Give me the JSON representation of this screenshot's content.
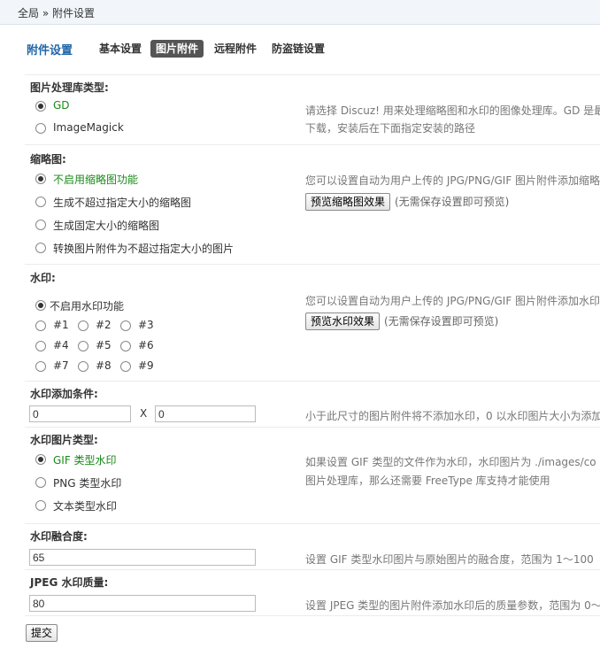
{
  "breadcrumb": "全局 » 附件设置",
  "tabs": {
    "title": "附件设置",
    "items": [
      "基本设置",
      "图片附件",
      "远程附件",
      "防盗链设置"
    ]
  },
  "image_lib": {
    "label": "图片处理库类型:",
    "options": [
      "GD",
      "ImageMagick"
    ],
    "tip1": "请选择 Discuz! 用来处理缩略图和水印的图像处理库。GD 是最",
    "tip2": "下载，安装后在下面指定安装的路径"
  },
  "thumb": {
    "label": "缩略图:",
    "options": [
      "不启用缩略图功能",
      "生成不超过指定大小的缩略图",
      "生成固定大小的缩略图",
      "转换图片附件为不超过指定大小的图片"
    ],
    "tip": "您可以设置自动为用户上传的 JPG/PNG/GIF 图片附件添加缩略",
    "preview_button": "预览缩略图效果",
    "preview_note": "(无需保存设置即可预览)"
  },
  "watermark": {
    "label": "水印:",
    "none_label": "不启用水印功能",
    "positions": [
      "#1",
      "#2",
      "#3",
      "#4",
      "#5",
      "#6",
      "#7",
      "#8",
      "#9"
    ],
    "tip": "您可以设置自动为用户上传的 JPG/PNG/GIF 图片附件添加水印",
    "preview_button": "预览水印效果",
    "preview_note": "(无需保存设置即可预览)"
  },
  "condition": {
    "label": "水印添加条件:",
    "width_value": "0",
    "separator": "X",
    "height_value": "0",
    "tip": "小于此尺寸的图片附件将不添加水印，0 以水印图片大小为添加"
  },
  "wm_type": {
    "label": "水印图片类型:",
    "options": [
      "GIF 类型水印",
      "PNG 类型水印",
      "文本类型水印"
    ],
    "tip1": "如果设置 GIF 类型的文件作为水印，水印图片为 ./images/co",
    "tip2": "图片处理库，那么还需要 FreeType 库支持才能使用"
  },
  "blend": {
    "label": "水印融合度:",
    "value": "65",
    "tip": "设置 GIF 类型水印图片与原始图片的融合度，范围为 1～100"
  },
  "quality": {
    "label": "JPEG 水印质量:",
    "value": "80",
    "tip": "设置 JPEG 类型的图片附件添加水印后的质量参数，范围为 0～"
  },
  "submit_label": "提交"
}
